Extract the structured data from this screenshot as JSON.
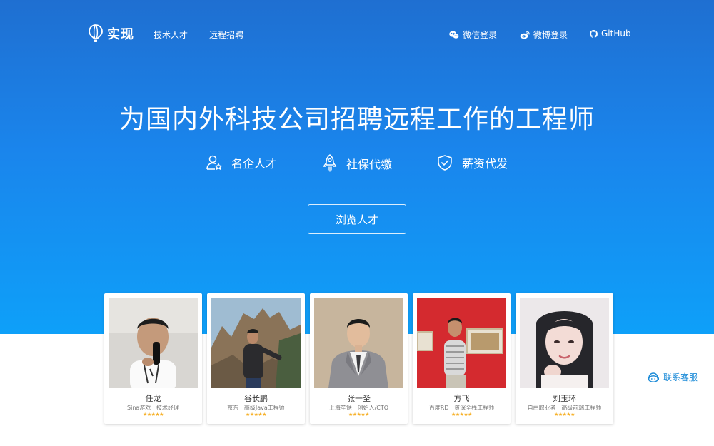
{
  "nav": {
    "brand": "实现",
    "links": [
      "技术人才",
      "远程招聘"
    ],
    "wechat_login": "微信登录",
    "weibo_login": "微博登录",
    "github": "GitHub"
  },
  "hero": {
    "headline": "为国内外科技公司招聘远程工作的工程师",
    "features": [
      "名企人才",
      "社保代缴",
      "薪资代发"
    ],
    "cta": "浏览人才"
  },
  "talents": [
    {
      "name": "任龙",
      "company": "Sina游戏",
      "title": "技术经理",
      "stars": "★★★★★"
    },
    {
      "name": "谷长鹏",
      "company": "京东",
      "title": "高级Java工程师",
      "stars": "★★★★★"
    },
    {
      "name": "张一圣",
      "company": "上海笙惬",
      "title": "创始人/CTO",
      "stars": "★★★★★"
    },
    {
      "name": "方飞",
      "company": "百度RD",
      "title": "资深全栈工程师",
      "stars": "★★★★★"
    },
    {
      "name": "刘玉环",
      "company": "自由职业者",
      "title": "高级前端工程师",
      "stars": "★★★★★"
    }
  ],
  "support": {
    "label": "联系客服"
  },
  "colors": {
    "hero_top": "#1f6fd1",
    "hero_bottom": "#0ea0f9",
    "star": "#f6b12a",
    "support": "#1e8cd8"
  }
}
